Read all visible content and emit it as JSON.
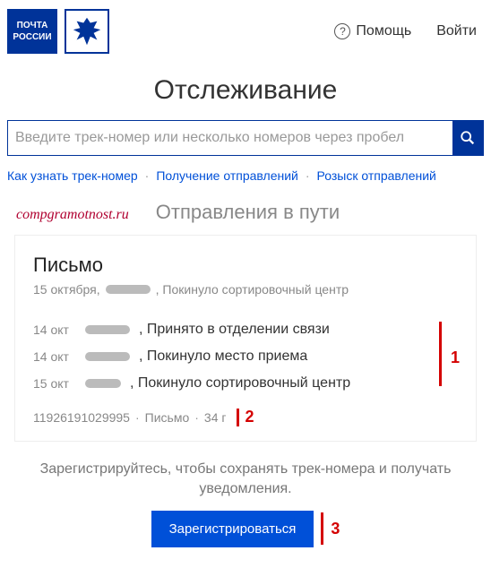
{
  "header": {
    "logo_line1": "ПОЧТА",
    "logo_line2": "РОССИИ",
    "help_label": "Помощь",
    "login_label": "Войти"
  },
  "page_title": "Отслеживание",
  "search": {
    "placeholder": "Введите трек-номер или несколько номеров через пробел"
  },
  "links": {
    "how": "Как узнать трек-номер",
    "receive": "Получение отправлений",
    "search_ship": "Розыск отправлений"
  },
  "watermark": "compgramotnost.ru",
  "section_title": "Отправления в пути",
  "item": {
    "title": "Письмо",
    "subtitle_date": "15 октября,",
    "subtitle_tail": ", Покинуло сортировочный центр"
  },
  "timeline": [
    {
      "date": "14 окт",
      "text": ", Принято в отделении связи"
    },
    {
      "date": "14 окт",
      "text": ", Покинуло место приема"
    },
    {
      "date": "15 окт",
      "text": ", Покинуло сортировочный центр"
    }
  ],
  "meta": {
    "track": "11926191029995",
    "type": "Письмо",
    "weight": "34 г"
  },
  "annotations": {
    "n1": "1",
    "n2": "2",
    "n3": "3"
  },
  "promo_text": "Зарегистрируйтесь, чтобы сохранять трек-номера и получать уведомления.",
  "register_label": "Зарегистрироваться"
}
